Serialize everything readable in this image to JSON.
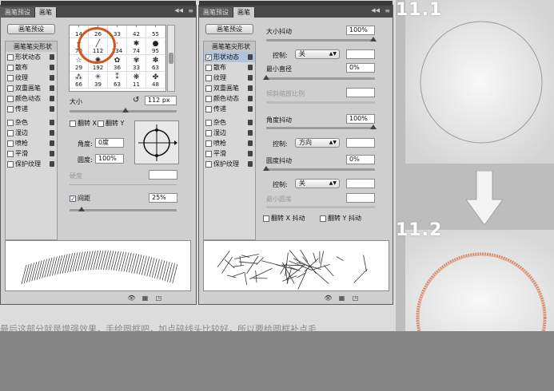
{
  "panel1": {
    "tabs": [
      "画笔预设",
      "画笔"
    ],
    "preset_button": "画笔预设",
    "list": [
      {
        "label": "画笔笔尖形状",
        "header": true
      },
      {
        "label": "形状动态",
        "checked": false
      },
      {
        "label": "散布",
        "checked": false
      },
      {
        "label": "纹理",
        "checked": false
      },
      {
        "label": "双重画笔",
        "checked": false
      },
      {
        "label": "颜色动态",
        "checked": false
      },
      {
        "label": "传递",
        "checked": false
      },
      {
        "label": "",
        "sep": true
      },
      {
        "label": "杂色",
        "checked": false
      },
      {
        "label": "湿边",
        "checked": false
      },
      {
        "label": "喷枪",
        "checked": false
      },
      {
        "label": "平滑",
        "checked": false
      },
      {
        "label": "保护纹理",
        "checked": false
      }
    ],
    "brush_grid": [
      {
        "icon": "·",
        "num": "14"
      },
      {
        "icon": "·",
        "num": "26"
      },
      {
        "icon": "·",
        "num": "33"
      },
      {
        "icon": "·",
        "num": "42"
      },
      {
        "icon": "·",
        "num": "55"
      },
      {
        "icon": "✦",
        "num": "70"
      },
      {
        "icon": "╱",
        "num": "112"
      },
      {
        "icon": "·",
        "num": "134"
      },
      {
        "icon": "✱",
        "num": "74"
      },
      {
        "icon": "●",
        "num": "95"
      },
      {
        "icon": "☆",
        "num": "29"
      },
      {
        "icon": "✺",
        "num": "192"
      },
      {
        "icon": "✿",
        "num": "36"
      },
      {
        "icon": "✾",
        "num": "33"
      },
      {
        "icon": "✽",
        "num": "63"
      },
      {
        "icon": "⁂",
        "num": "66"
      },
      {
        "icon": "✳",
        "num": "39"
      },
      {
        "icon": "⁑",
        "num": "63"
      },
      {
        "icon": "❋",
        "num": "11"
      },
      {
        "icon": "✤",
        "num": "48"
      }
    ],
    "size_label": "大小",
    "size_value": "112 px",
    "flip_x": "翻转 X",
    "flip_y": "翻转 Y",
    "angle_label": "角度:",
    "angle_value": "0度",
    "roundness_label": "圆度:",
    "roundness_value": "100%",
    "hardness_label": "硬度",
    "spacing_label": "间距",
    "spacing_value": "25%"
  },
  "panel2": {
    "tabs": [
      "画笔预设",
      "画笔"
    ],
    "preset_button": "画笔预设",
    "list": [
      {
        "label": "画笔笔尖形状",
        "header": true
      },
      {
        "label": "形状动态",
        "checked": true,
        "selected": true
      },
      {
        "label": "散布",
        "checked": false
      },
      {
        "label": "纹理",
        "checked": false
      },
      {
        "label": "双重画笔",
        "checked": false
      },
      {
        "label": "颜色动态",
        "checked": false
      },
      {
        "label": "传递",
        "checked": false
      },
      {
        "label": "",
        "sep": true
      },
      {
        "label": "杂色",
        "checked": false
      },
      {
        "label": "湿边",
        "checked": false
      },
      {
        "label": "喷枪",
        "checked": false
      },
      {
        "label": "平滑",
        "checked": false
      },
      {
        "label": "保护纹理",
        "checked": false
      }
    ],
    "size_jitter_label": "大小抖动",
    "size_jitter_value": "100%",
    "control_label": "控制:",
    "control1_value": "关",
    "min_diameter_label": "最小直径",
    "min_diameter_value": "0%",
    "tilt_scale_label": "倾斜缩放比例",
    "angle_jitter_label": "角度抖动",
    "angle_jitter_value": "100%",
    "control2_value": "方向",
    "roundness_jitter_label": "圆度抖动",
    "roundness_jitter_value": "0%",
    "control3_value": "关",
    "min_roundness_label": "最小圆度",
    "flip_x_jitter": "翻转 X 抖动",
    "flip_y_jitter": "翻转 Y 抖动"
  },
  "right": {
    "step1": "11.1",
    "step2": "11.2",
    "accent": "#d2561e"
  },
  "caption": "最后这部分就是增强效果，手绘圆框吧，加点碎线头比较好，所以要给圆框补点毛"
}
